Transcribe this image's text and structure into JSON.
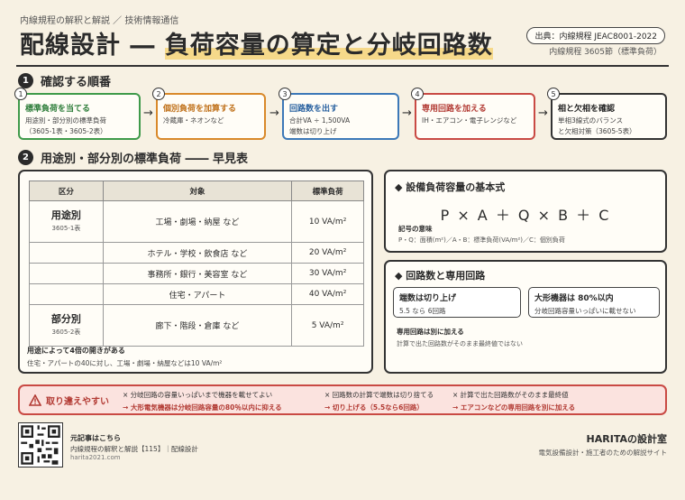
{
  "header": {
    "kicker": "内線規程の解釈と解説 ／ 技術情報通信",
    "title_prefix": "配線設計 ―",
    "title_highlight": "負荷容量の算定と分岐回路数",
    "source_label": "出典：内線規程 JEAC8001-2022",
    "source_sub": "内線規程 3605節（標準負荷）"
  },
  "section1": {
    "number": "1",
    "title": "確認する順番",
    "steps": [
      {
        "badge": "1",
        "title": "標準負荷を当てる",
        "desc1": "用途別・部分別の標準負荷",
        "desc2": "（3605-1表・3605-2表）",
        "color": "#3f9a4a",
        "title_color": "#2e7d3a"
      },
      {
        "badge": "2",
        "title": "個別負荷を加算する",
        "desc1": "冷蔵庫・ネオンなど",
        "desc2": "",
        "color": "#d9892a",
        "title_color": "#c0711a"
      },
      {
        "badge": "3",
        "title": "回路数を出す",
        "desc1": "合計VA ÷ 1,500VA",
        "desc2": "端数は切り上げ",
        "color": "#3c78b8",
        "title_color": "#2a62a0"
      },
      {
        "badge": "4",
        "title": "専用回路を加える",
        "desc1": "IH・エアコン・電子レンジなど",
        "desc2": "",
        "color": "#c94a44",
        "title_color": "#b23a33"
      },
      {
        "badge": "5",
        "title": "相と欠相を確認",
        "desc1": "単相3線式のバランス",
        "desc2": "と欠相対策（3605-5表）",
        "color": "#333333",
        "title_color": "#222222"
      }
    ],
    "arrow": "→"
  },
  "section2": {
    "number": "2",
    "title": "用途別・部分別の標準負荷 ―― 早見表"
  },
  "table": {
    "headers": [
      "区分",
      "対象",
      "標準負荷"
    ],
    "cat1": {
      "name": "用途別",
      "ref": "3605-1表"
    },
    "cat2": {
      "name": "部分別",
      "ref": "3605-2表"
    },
    "rows": [
      {
        "target": "工場・劇場・納屋 など",
        "load": "10 VA/m²"
      },
      {
        "target": "ホテル・学校・飲食店 など",
        "load": "20 VA/m²"
      },
      {
        "target": "事務所・銀行・美容室 など",
        "load": "30 VA/m²"
      },
      {
        "target": "住宅・アパート",
        "load": "40 VA/m²"
      },
      {
        "target": "廊下・階段・倉庫 など",
        "load": "5 VA/m²"
      }
    ],
    "note_title": "用途によって4倍の開きがある",
    "note_desc": "住宅・アパートの40に対し、工場・劇場・納屋などは10 VA/m²"
  },
  "formula_panel": {
    "title": "設備負荷容量の基本式",
    "formula": "P × A ＋ Q × B ＋ C",
    "symbol_title": "記号の意味",
    "symbol_desc": "P・Q：面積(m²)／A・B：標準負荷(VA/m²)／C：個別負荷"
  },
  "circuit_panel": {
    "title": "回路数と専用回路",
    "box1_title": "端数は切り上げ",
    "box1_desc": "5.5 なら 6回路",
    "box2_title": "大形機器は 80%以内",
    "box2_desc": "分岐回路容量いっぱいに載せない",
    "dedicated_title": "専用回路は別に加える",
    "dedicated_desc": "計算で出た回路数がそのまま最終値ではない"
  },
  "warning": {
    "label": "取り違えやすい",
    "items": [
      {
        "mistake": "× 分岐回路の容量いっぱいまで機器を載せてよい",
        "correct": "→ 大形電気機器は分岐回路容量の80％以内に抑える"
      },
      {
        "mistake": "× 回路数の計算で端数は切り捨てる",
        "correct": "→ 切り上げる（5.5なら6回路）"
      },
      {
        "mistake": "× 計算で出た回路数がそのまま最終値",
        "correct": "→ エアコンなどの専用回路を別に加える"
      }
    ]
  },
  "footer": {
    "qr_title": "元記事はこちら",
    "qr_desc": "内線規程の解釈と解説【115】｜配線設計",
    "qr_url": "harita2021.com",
    "brand": "HARITAの設計室",
    "brand_sub": "電気設備設計・施工者のための解説サイト"
  },
  "colors": {
    "warning": "#c94a44",
    "highlight": "#f6d98a",
    "background": "#f7f1e3"
  }
}
